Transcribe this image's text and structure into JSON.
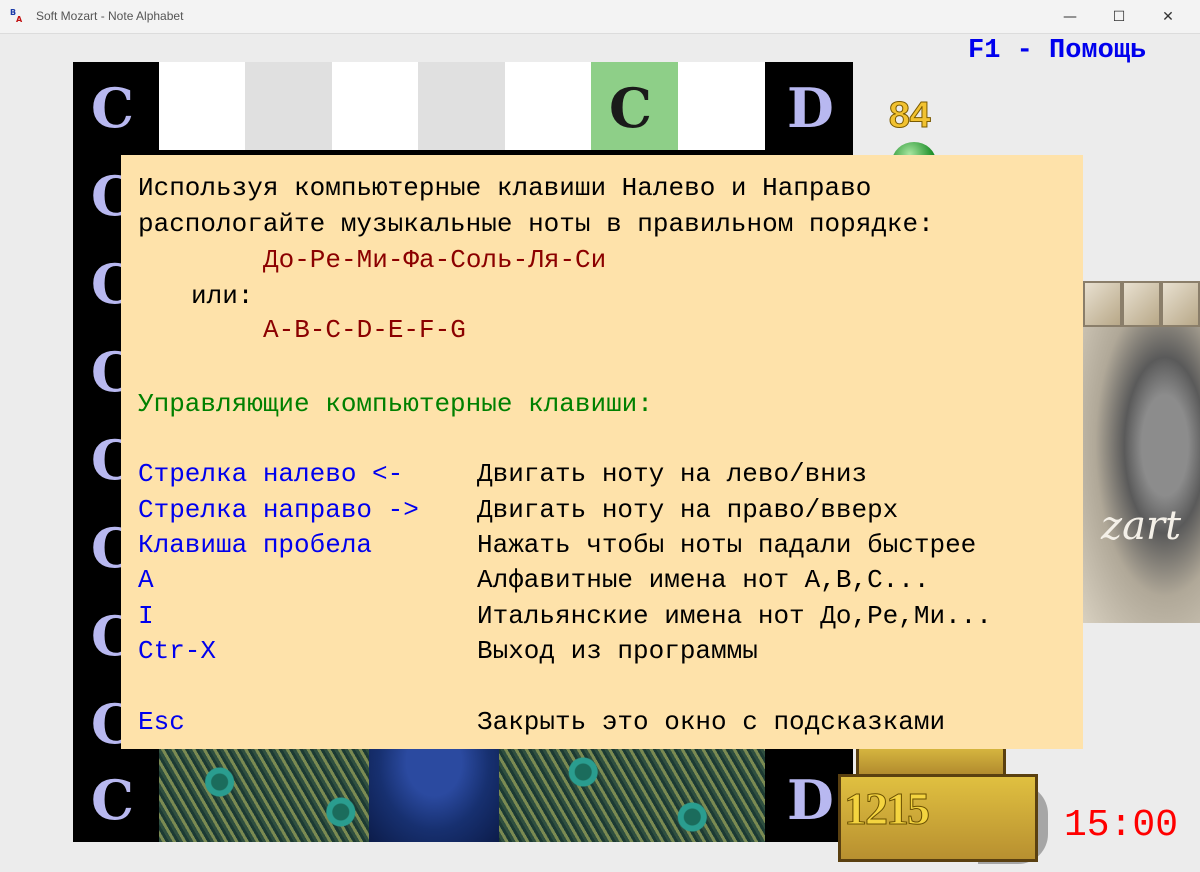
{
  "window": {
    "title": "Soft Mozart - Note Alphabet",
    "icon_letters": [
      "B",
      "A"
    ],
    "minimize_glyph": "—",
    "maximize_glyph": "☐",
    "close_glyph": "✕"
  },
  "game": {
    "help_link": "F1 - Помощь",
    "left_column_letters": [
      "C",
      "C",
      "C",
      "C",
      "C",
      "C",
      "C",
      "C",
      "C",
      "C"
    ],
    "right_column_letters": [
      "D",
      "D"
    ],
    "highlighted_note": "C",
    "score": "84",
    "chest_score": "1215",
    "timer": "15:00",
    "portrait_signature": "zart",
    "colors": {
      "keys_white": "#ffffff",
      "keys_gray": "#e0e0e0",
      "highlight_green": "#8ecf88",
      "letter_lavender": "#b8b8f0",
      "help_bg": "#fee2aa"
    }
  },
  "help": {
    "intro_line1": "Используя компьютерные клавиши Налево и Направо",
    "intro_line2": "распологайте музыкальные ноты в правильном порядке:",
    "solfege": "До-Ре-Ми-Фа-Соль-Ля-Си",
    "or": "или:",
    "alphabet": "A-B-C-D-E-F-G",
    "controls_header": "Управляющие компьютерные клавиши:",
    "controls": [
      {
        "key": "Стрелка налево <-",
        "action": "Двигать ноту на лево/вниз"
      },
      {
        "key": "Стрелка направо ->",
        "action": "Двигать ноту на право/вверх"
      },
      {
        "key": "Клавиша пробела",
        "action": "Нажать чтобы ноты падали быстрее"
      },
      {
        "key": "A",
        "action": "Алфавитные имена нот A,B,C..."
      },
      {
        "key": "I",
        "action": "Итальянские имена нот До,Ре,Ми..."
      },
      {
        "key": "Ctr-X",
        "action": "Выход из программы"
      }
    ],
    "esc": {
      "key": "Esc",
      "action": "Закрыть это окно с подсказками"
    }
  }
}
